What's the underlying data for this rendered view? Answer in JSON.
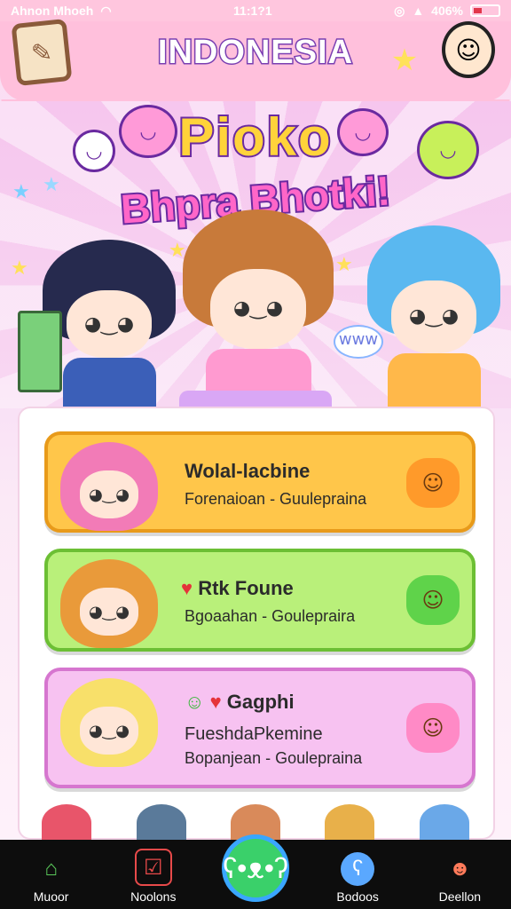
{
  "status_bar": {
    "carrier": "Ahnon Mhoeh",
    "time": "11:1?1",
    "battery": "406%"
  },
  "header": {
    "title": "INDONESIA",
    "star_icon": "star-icon",
    "menu_icon": "scroll-icon",
    "avatar_icon": "avatar-icon"
  },
  "hero": {
    "logo_line1": "Pioko",
    "logo_line2": "Bhpra Bhotki!",
    "speech": "www"
  },
  "cards": [
    {
      "title": "Wolal-lacbine",
      "subtitle": "Forenaioan - Guulepraina",
      "color": "#ffc64a",
      "border": "#e89a1a",
      "thumb": "#f27bb7",
      "badge": "#ff9a2a",
      "badge_icon": "☺"
    },
    {
      "title": "Rtk Foune",
      "subtitle": "Bgoaahan - Goulepraira",
      "color": "#b9f07a",
      "border": "#6cbf34",
      "thumb": "#e99a3a",
      "badge": "#5fd34a",
      "badge_icon": "☺",
      "heart": "♥"
    },
    {
      "title": "Gagphi",
      "subtitle": "FueshdaPkemine",
      "subtitle2": "Bopanjean - Goulepraina",
      "color": "#f7c2f1",
      "border": "#d676cf",
      "thumb": "#f8e06a",
      "badge": "#ff8ac6",
      "badge_icon": "☺",
      "heart": "♥"
    }
  ],
  "nav": {
    "items": [
      {
        "label": "Muoor",
        "icon": "home-icon",
        "glyph": "⌂",
        "color": "#5ac85a"
      },
      {
        "label": "Noolons",
        "icon": "checkbox-icon",
        "glyph": "☑",
        "color": "#e84a4a"
      },
      {
        "label": "",
        "icon": "cat-icon",
        "glyph": "🐱",
        "color": "#3ad06a"
      },
      {
        "label": "Bodoos",
        "icon": "bear-icon",
        "glyph": "ʕ",
        "color": "#5aa8ff"
      },
      {
        "label": "Deellon",
        "icon": "character-icon",
        "glyph": "☻",
        "color": "#ff7a5a"
      }
    ]
  }
}
